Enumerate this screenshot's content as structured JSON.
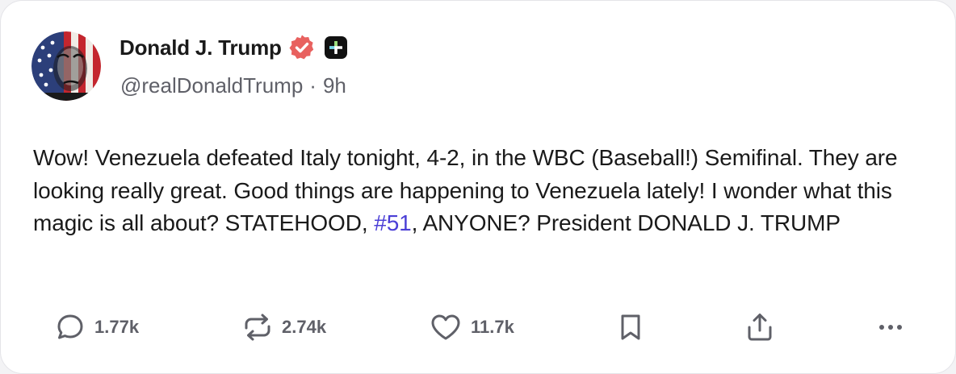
{
  "post": {
    "author": {
      "display_name": "Donald J. Trump",
      "handle": "@realDonaldTrump",
      "separator": "·",
      "time_ago": "9h"
    },
    "body": {
      "text_before": "Wow! Venezuela defeated Italy tonight, 4-2, in the WBC (Baseball!) Semifinal. They are looking really great. Good things are happening to Venezuela lately! I wonder what this magic is all about? STATEHOOD, ",
      "hashtag": "#51",
      "text_after": ", ANYONE? President DONALD J. TRUMP"
    },
    "actions": {
      "reply": {
        "icon": "comment-icon",
        "count": "1.77k"
      },
      "repost": {
        "icon": "repost-icon",
        "count": "2.74k"
      },
      "like": {
        "icon": "heart-icon",
        "count": "11.7k"
      },
      "bookmark": {
        "icon": "bookmark-icon"
      },
      "share": {
        "icon": "share-icon"
      },
      "more": {
        "icon": "more-icon"
      }
    }
  },
  "colors": {
    "verified_badge": "#e8615f",
    "hashtag": "#4b3fd6",
    "secondary_text": "#5f6068",
    "plus_badge": "#111111"
  }
}
